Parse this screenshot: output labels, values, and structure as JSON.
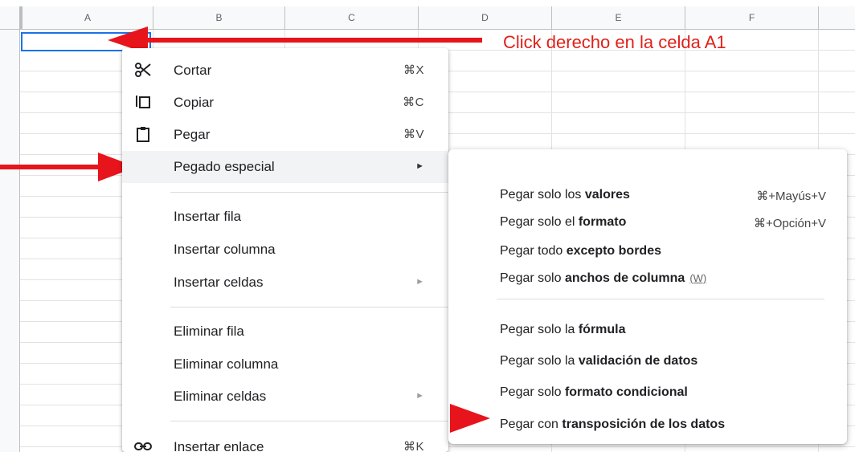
{
  "sheet": {
    "columns": [
      "A",
      "B",
      "C",
      "D",
      "E",
      "F"
    ]
  },
  "annotation": {
    "text": "Click derecho en la celda A1",
    "color": "#e0201a"
  },
  "context_menu": {
    "cut": {
      "label": "Cortar",
      "shortcut": "⌘X",
      "icon": "scissors-icon"
    },
    "copy": {
      "label": "Copiar",
      "shortcut": "⌘C",
      "icon": "copy-icon"
    },
    "paste": {
      "label": "Pegar",
      "shortcut": "⌘V",
      "icon": "clipboard-icon"
    },
    "paste_special": {
      "label": "Pegado especial",
      "submenu_arrow": "►"
    },
    "insert_row": {
      "label": "Insertar fila"
    },
    "insert_column": {
      "label": "Insertar columna"
    },
    "insert_cells": {
      "label": "Insertar celdas",
      "submenu_arrow": "►"
    },
    "delete_row": {
      "label": "Eliminar fila"
    },
    "delete_column": {
      "label": "Eliminar columna"
    },
    "delete_cells": {
      "label": "Eliminar celdas",
      "submenu_arrow": "►"
    },
    "insert_link": {
      "label": "Insertar enlace",
      "shortcut": "⌘K",
      "icon": "link-icon"
    }
  },
  "paste_special_submenu": {
    "values": {
      "prefix": "Pegar solo los ",
      "bold": "valores",
      "shortcut": "⌘+Mayús+V"
    },
    "format": {
      "prefix": "Pegar solo el ",
      "bold": "formato",
      "shortcut": "⌘+Opción+V"
    },
    "all_except_borders": {
      "prefix": "Pegar todo ",
      "bold": "excepto bordes"
    },
    "column_widths": {
      "prefix": "Pegar solo ",
      "bold": "anchos de columna",
      "hint": "(W)"
    },
    "formula": {
      "prefix": "Pegar solo la ",
      "bold": "fórmula"
    },
    "data_validation": {
      "prefix": "Pegar solo la ",
      "bold": "validación de datos"
    },
    "conditional_format": {
      "prefix": "Pegar solo ",
      "bold": "formato condicional"
    },
    "transpose": {
      "prefix": "Pegar con ",
      "bold": "transposición de los datos"
    }
  },
  "colors": {
    "selection": "#1a73e8",
    "arrow": "#e8141b",
    "highlight": "#f1f3f4"
  }
}
